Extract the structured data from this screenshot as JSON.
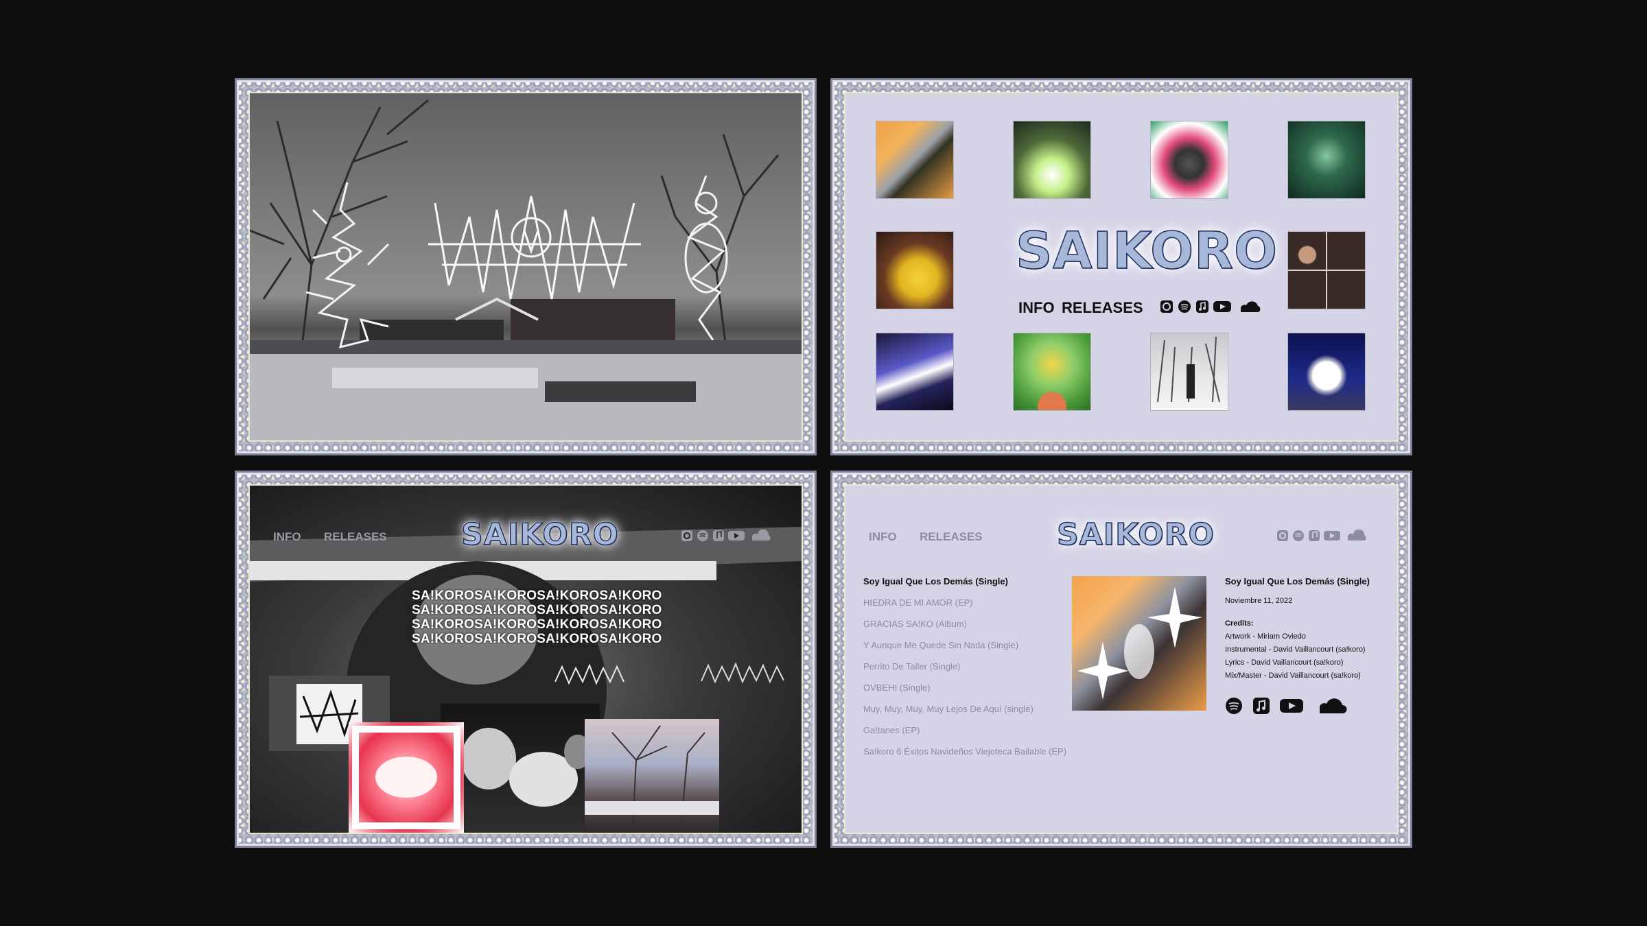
{
  "brand": {
    "logo": "SAIKORO"
  },
  "nav": {
    "info": "INFO",
    "releases": "RELEASES"
  },
  "social_icons": [
    "instagram-icon",
    "spotify-icon",
    "apple-music-icon",
    "youtube-icon",
    "soundcloud-icon"
  ],
  "marquee": {
    "lines": [
      "SA!KOROSA!KOROSA!KOROSA!KORO",
      "SA!KOROSA!KOROSA!KOROSA!KORO",
      "SA!KOROSA!KOROSA!KOROSA!KORO",
      "SA!KOROSA!KOROSA!KOROSA!KORO"
    ]
  },
  "releases": [
    "Soy Igual Que Los Demás (Single)",
    "HIEDRA DE MI AMOR (EP)",
    "GRACIAS SA!KO (Álbum)",
    "Y Aunque Me Quede Sin Nada (Single)",
    "Perrito De Taller (Single)",
    "OVBEH! (Single)",
    "Muy, Muy, Muy, Muy Lejos De Aquí (single)",
    "Ga!tanes (EP)",
    "Sa!koro 6 Éxitos Navideños Viejoteca Bailable (EP)"
  ],
  "selected_release": {
    "title": "Soy Igual Que Los Demás (Single)",
    "date": "Noviembre 11, 2022",
    "credits_label": "Credits:",
    "credits": [
      "Artwork - Miriam Oviedo",
      "Instrumental - David Vaillancourt (sa!koro)",
      "Lyrics - David Vaillancourt (sa!koro)",
      "Mix/Master - David Vaillancourt (sa!koro)"
    ],
    "links": [
      "spotify-icon",
      "apple-music-icon",
      "youtube-icon",
      "soundcloud-icon"
    ]
  },
  "colors": {
    "background": "#0e0e0e",
    "lavender": "#d5d3e6",
    "frame": "#b9bccb"
  }
}
